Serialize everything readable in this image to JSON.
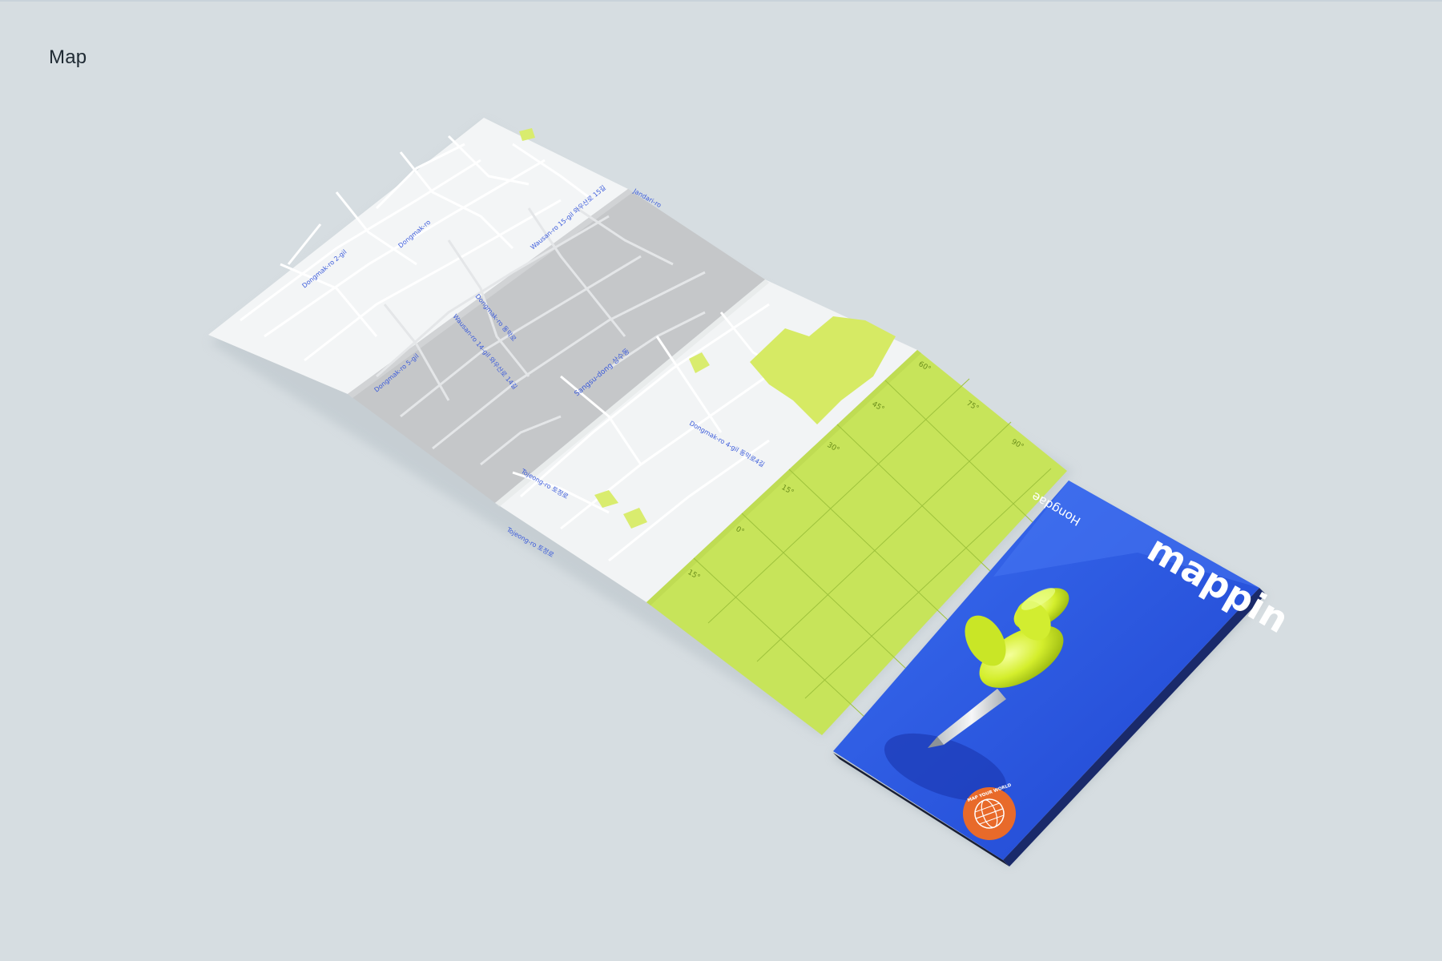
{
  "page": {
    "title": "Map"
  },
  "folded_map": {
    "streets": [
      "Dongmak-ro",
      "Wausan-ro 15-gil 와우산로 15길",
      "Wausan-ro 14-gil 와우산로 14길",
      "Dongmak-ro 동막로",
      "Sangsu-dong 상수동",
      "Dongmak-ro 5-gil",
      "Tojeong-ro 토정로",
      "Jandari-ro",
      "Dongmak-ro 2-gil",
      "Dongmak-ro 4-gil 동막로4길",
      "Tojeong-ro 토정로"
    ],
    "grid_degrees": [
      "60°",
      "45°",
      "75°",
      "30°",
      "90°",
      "15°",
      "0°",
      "15°"
    ]
  },
  "cover": {
    "brand": "mappin",
    "subtitle": "Hongdae",
    "seal_text": "MAP YOUR WORLD"
  },
  "colors": {
    "background": "#d6dde1",
    "map_paper": "#f2f4f5",
    "map_gray_panel": "#c4c6c8",
    "park_green": "#d4e86a",
    "grid_green": "#c6e35a",
    "cover_blue": "#2f5fe0",
    "pin_yellow": "#d6ef3c",
    "seal_orange": "#e86a2a",
    "street_label_blue": "#3b5bdb"
  }
}
